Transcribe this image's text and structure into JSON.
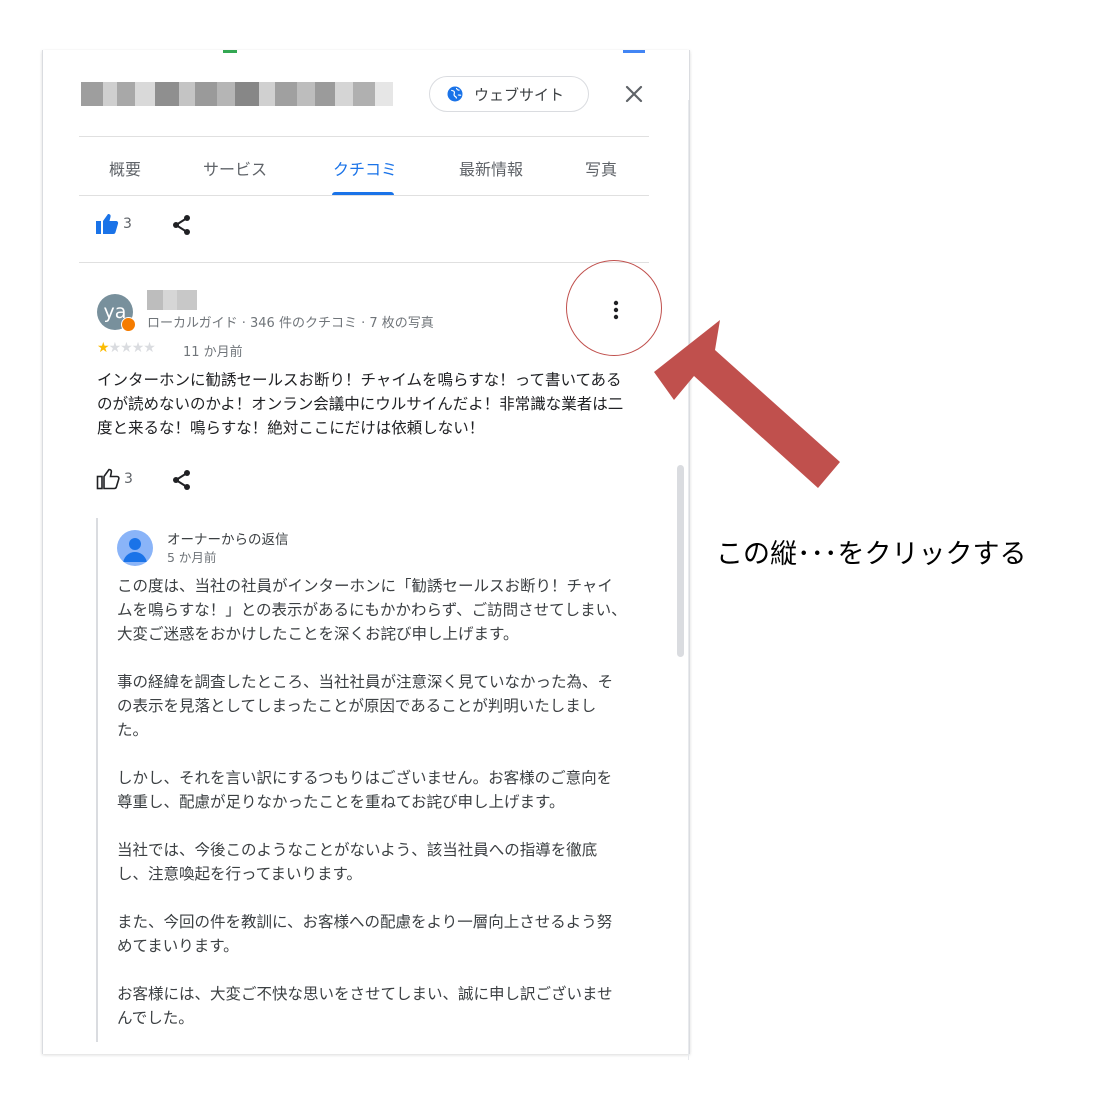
{
  "header": {
    "website_button": "ウェブサイト",
    "close_label": "×"
  },
  "tabs": [
    {
      "label": "概要",
      "active": false
    },
    {
      "label": "サービス",
      "active": false
    },
    {
      "label": "クチコミ",
      "active": true
    },
    {
      "label": "最新情報",
      "active": false
    },
    {
      "label": "写真",
      "active": false
    }
  ],
  "prev_review": {
    "likes": "3"
  },
  "review": {
    "avatar_initials": "ya",
    "meta": "ローカルガイド · 346 件のクチコミ · 7 枚の写真",
    "rating": 1,
    "rating_max": 5,
    "time": "11 か月前",
    "text": "インターホンに勧誘セールスお断り！チャイムを鳴らすな！って書いてあるのが読めないのかよ！オンラン会議中にウルサイんだよ！非常識な業者は二度と来るな！鳴らすな！絶対ここにだけは依頼しない！",
    "likes": "3"
  },
  "reply": {
    "title": "オーナーからの返信",
    "time": "5 か月前",
    "paragraphs": [
      "この度は、当社の社員がインターホンに「勧誘セールスお断り！チャイムを鳴らすな！」との表示があるにもかかわらず、ご訪問させてしまい、大変ご迷惑をおかけしたことを深くお詫び申し上げます。",
      "事の経緯を調査したところ、当社社員が注意深く見ていなかった為、その表示を見落としてしまったことが原因であることが判明いたしました。",
      "しかし、それを言い訳にするつもりはございません。お客様のご意向を尊重し、配慮が足りなかったことを重ねてお詫び申し上げます。",
      "当社では、今後このようなことがないよう、該当社員への指導を徹底し、注意喚起を行ってまいります。",
      "また、今回の件を教訓に、お客様への配慮をより一層向上させるよう努めてまいります。",
      "お客様には、大変ご不快な思いをさせてしまい、誠に申し訳ございませんでした。"
    ]
  },
  "annotation": {
    "text": "この縦･･･をクリックする"
  },
  "colors": {
    "accent": "#1a73e8",
    "annotation_red": "#c0504d",
    "star": "#fbbc04"
  }
}
